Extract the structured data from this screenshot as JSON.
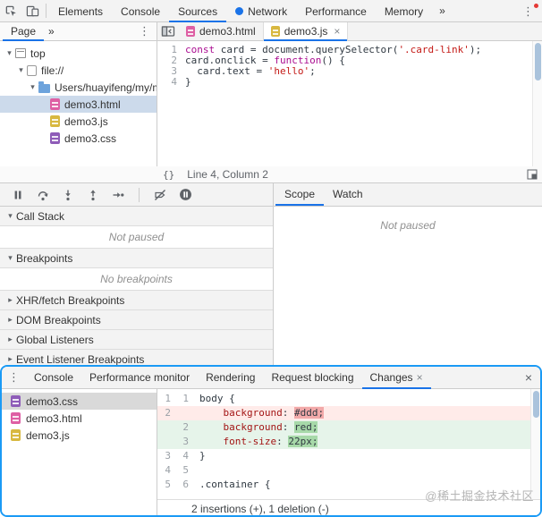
{
  "colors": {
    "accent": "#1a73e8",
    "highlight_border": "#1a9af5",
    "deleted_row_bg": "#ffebe9",
    "deleted_word_bg": "#f2a9a9",
    "added_row_bg": "#e6f4ea",
    "added_word_bg": "#a7d9a9",
    "keyword": "#aa0d91",
    "string": "#c41a16",
    "html_icon": "#de5fa4",
    "js_icon": "#d8b840",
    "css_icon": "#8e5cb8",
    "error_badge": "#e53935"
  },
  "icons": {
    "kebab": "⋮",
    "close": "×",
    "more": "»",
    "expand_down": "▾",
    "expand_right": "▸"
  },
  "top_toolbar": {
    "tabs": [
      {
        "label": "Elements",
        "selected": false
      },
      {
        "label": "Console",
        "selected": false
      },
      {
        "label": "Sources",
        "selected": true
      },
      {
        "label": "Network",
        "selected": false,
        "badge": true
      },
      {
        "label": "Performance",
        "selected": false
      },
      {
        "label": "Memory",
        "selected": false
      }
    ]
  },
  "navigator": {
    "tab_label": "Page",
    "tree": [
      {
        "label": "top",
        "depth": 0,
        "icon": "frame",
        "expander": "▾"
      },
      {
        "label": "file://",
        "depth": 1,
        "icon": "origin",
        "expander": "▾"
      },
      {
        "label": "Users/huayifeng/my/m",
        "depth": 2,
        "icon": "folder",
        "expander": "▾"
      },
      {
        "label": "demo3.html",
        "depth": 3,
        "icon": "html",
        "selected": true
      },
      {
        "label": "demo3.js",
        "depth": 3,
        "icon": "js"
      },
      {
        "label": "demo3.css",
        "depth": 3,
        "icon": "css"
      }
    ]
  },
  "editor": {
    "tabs": [
      {
        "label": "demo3.html",
        "icon": "html",
        "selected": false,
        "closable": false
      },
      {
        "label": "demo3.js",
        "icon": "js",
        "selected": true,
        "closable": true
      }
    ],
    "lines": [
      {
        "num": 1,
        "tokens": [
          {
            "t": "const",
            "c": "kw"
          },
          {
            "t": " card = document.querySelector(",
            "c": "plain"
          },
          {
            "t": "'.card-link'",
            "c": "str"
          },
          {
            "t": ");",
            "c": "plain"
          }
        ]
      },
      {
        "num": 2,
        "tokens": [
          {
            "t": "card.onclick = ",
            "c": "plain"
          },
          {
            "t": "function",
            "c": "kw"
          },
          {
            "t": "() {",
            "c": "plain"
          }
        ]
      },
      {
        "num": 3,
        "tokens": [
          {
            "t": "  card.text = ",
            "c": "plain"
          },
          {
            "t": "'hello'",
            "c": "str"
          },
          {
            "t": ";",
            "c": "plain"
          }
        ]
      },
      {
        "num": 4,
        "tokens": [
          {
            "t": "}",
            "c": "plain"
          }
        ]
      }
    ],
    "status": {
      "brackets": "{}",
      "position": "Line 4, Column 2"
    }
  },
  "debugger": {
    "sections": [
      {
        "title": "Call Stack",
        "expanded": true,
        "content": "Not paused"
      },
      {
        "title": "Breakpoints",
        "expanded": true,
        "content": "No breakpoints"
      },
      {
        "title": "XHR/fetch Breakpoints",
        "expanded": false
      },
      {
        "title": "DOM Breakpoints",
        "expanded": false
      },
      {
        "title": "Global Listeners",
        "expanded": false
      },
      {
        "title": "Event Listener Breakpoints",
        "expanded": false
      }
    ],
    "side_tabs": [
      {
        "label": "Scope",
        "selected": true
      },
      {
        "label": "Watch",
        "selected": false
      }
    ],
    "scope_message": "Not paused"
  },
  "drawer": {
    "tabs": [
      {
        "label": "Console",
        "selected": false
      },
      {
        "label": "Performance monitor",
        "selected": false
      },
      {
        "label": "Rendering",
        "selected": false
      },
      {
        "label": "Request blocking",
        "selected": false
      },
      {
        "label": "Changes",
        "selected": true,
        "closable": true
      }
    ],
    "files": [
      {
        "label": "demo3.css",
        "icon": "css",
        "selected": true
      },
      {
        "label": "demo3.html",
        "icon": "html"
      },
      {
        "label": "demo3.js",
        "icon": "js"
      }
    ],
    "diff": {
      "rows": [
        {
          "old": "1",
          "new": "1",
          "type": "ctx",
          "segments": [
            {
              "t": "body {",
              "c": "plain"
            }
          ]
        },
        {
          "old": "2",
          "new": "",
          "type": "del",
          "segments": [
            {
              "t": "    ",
              "c": "plain"
            },
            {
              "t": "background",
              "c": "prop"
            },
            {
              "t": ": ",
              "c": "plain"
            },
            {
              "t": "#ddd;",
              "c": "plain",
              "hl": true
            }
          ]
        },
        {
          "old": "",
          "new": "2",
          "type": "add",
          "segments": [
            {
              "t": "    ",
              "c": "plain"
            },
            {
              "t": "background",
              "c": "prop"
            },
            {
              "t": ": ",
              "c": "plain"
            },
            {
              "t": "red;",
              "c": "plain",
              "hl": true
            }
          ]
        },
        {
          "old": "",
          "new": "3",
          "type": "add",
          "segments": [
            {
              "t": "    ",
              "c": "plain"
            },
            {
              "t": "font-size",
              "c": "prop"
            },
            {
              "t": ": ",
              "c": "plain"
            },
            {
              "t": "22px;",
              "c": "plain",
              "hl": true
            }
          ]
        },
        {
          "old": "3",
          "new": "4",
          "type": "ctx",
          "segments": [
            {
              "t": "}",
              "c": "plain"
            }
          ]
        },
        {
          "old": "4",
          "new": "5",
          "type": "ctx",
          "segments": [
            {
              "t": "",
              "c": "plain"
            }
          ]
        },
        {
          "old": "5",
          "new": "6",
          "type": "ctx",
          "segments": [
            {
              "t": ".container {",
              "c": "plain"
            }
          ]
        }
      ],
      "footer": "2 insertions (+), 1 deletion (-)"
    }
  },
  "watermark": "@稀土掘金技术社区"
}
